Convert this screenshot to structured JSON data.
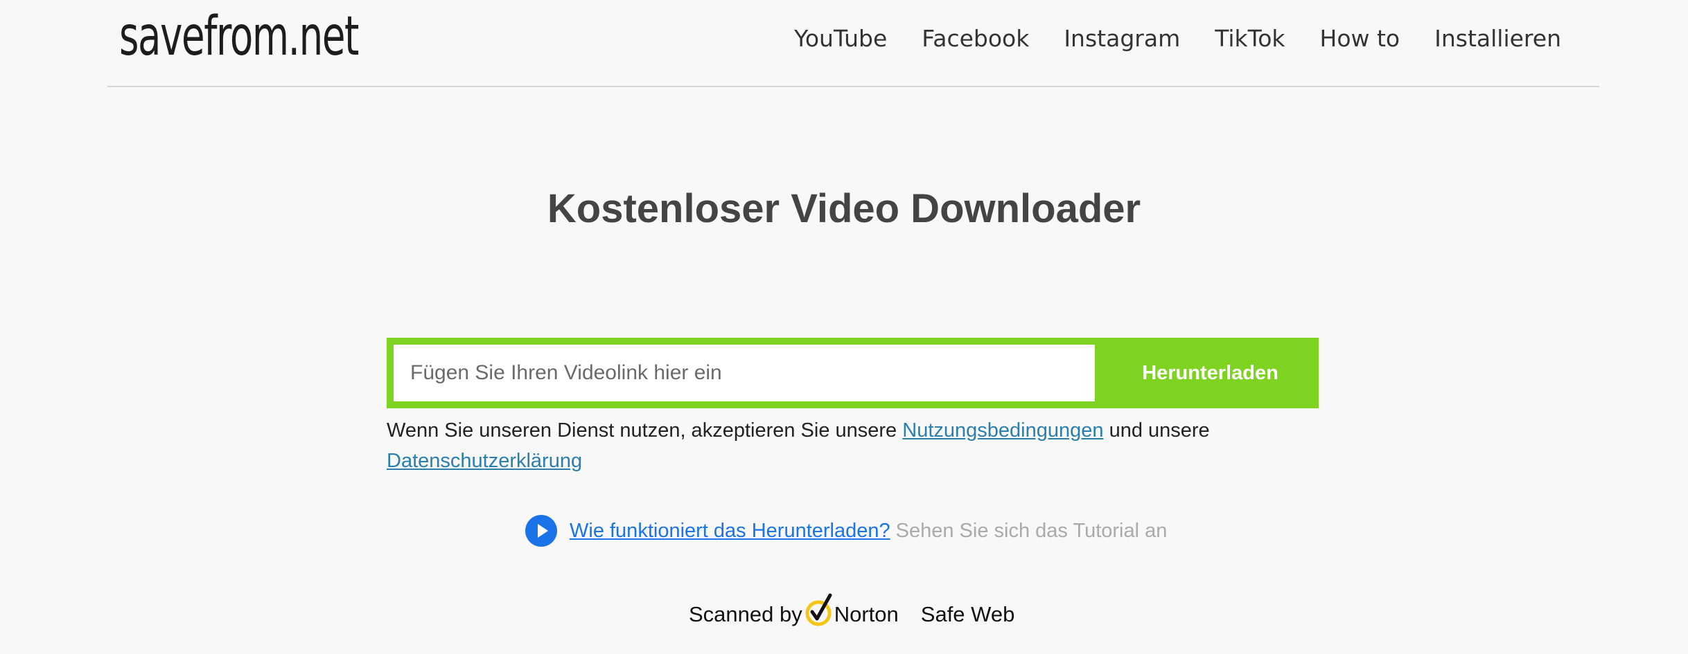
{
  "header": {
    "logo": "savefrom.net",
    "nav": [
      "YouTube",
      "Facebook",
      "Instagram",
      "TikTok",
      "How to",
      "Installieren"
    ]
  },
  "main": {
    "title": "Kostenloser Video Downloader",
    "form": {
      "placeholder": "Fügen Sie Ihren Videolink hier ein",
      "button_label": "Herunterladen"
    },
    "terms": {
      "text_before": "Wenn Sie unseren Dienst nutzen, akzeptieren Sie unsere",
      "terms_link": "Nutzungsbedingungen",
      "text_middle": "und unsere",
      "privacy_link": "Datenschutzerklärung"
    },
    "howto": {
      "link": "Wie funktioniert das Herunterladen?",
      "hint": "Sehen Sie sich das Tutorial an",
      "icon": "play-icon"
    },
    "badge": {
      "prefix": "Scanned by",
      "brand": "Norton",
      "suffix": "Safe Web",
      "icon": "norton-check-icon"
    }
  },
  "colors": {
    "accent": "#7ed321",
    "link": "#2a7fad",
    "play": "#1a73e8",
    "background": "#f8f8f8"
  }
}
